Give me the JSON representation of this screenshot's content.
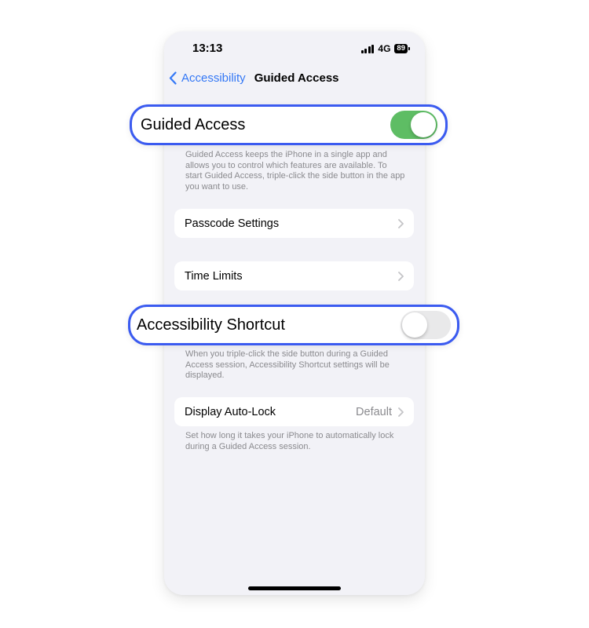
{
  "status_bar": {
    "time": "13:13",
    "network": "4G",
    "battery": "89"
  },
  "nav": {
    "back_label": "Accessibility",
    "title": "Guided Access"
  },
  "guided_access": {
    "label": "Guided Access",
    "state": "on",
    "description": "Guided Access keeps the iPhone in a single app and allows you to control which features are available. To start Guided Access, triple-click the side button in the app you want to use."
  },
  "passcode_settings": {
    "label": "Passcode Settings"
  },
  "time_limits": {
    "label": "Time Limits"
  },
  "accessibility_shortcut": {
    "label": "Accessibility Shortcut",
    "state": "off",
    "description": "When you triple-click the side button during a Guided Access session, Accessibility Shortcut settings will be displayed."
  },
  "display_auto_lock": {
    "label": "Display Auto-Lock",
    "value": "Default",
    "description": "Set how long it takes your iPhone to automatically lock during a Guided Access session."
  },
  "colors": {
    "accent": "#3478f6",
    "highlight_border": "#3b5bf0",
    "toggle_on": "#5ebd64",
    "toggle_off": "#e9e9ea",
    "background": "#f2f2f7"
  }
}
